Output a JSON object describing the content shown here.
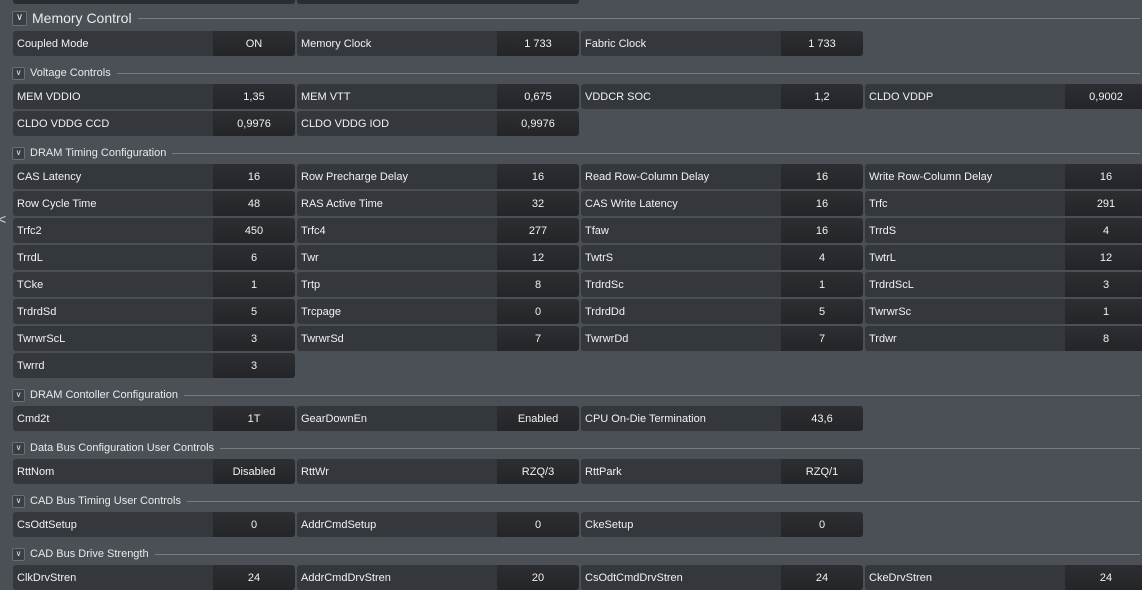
{
  "memory_control": {
    "title": "Memory Control",
    "fields": [
      {
        "label": "Coupled Mode",
        "value": "ON"
      },
      {
        "label": "Memory Clock",
        "value": "1 733"
      },
      {
        "label": "Fabric Clock",
        "value": "1 733"
      }
    ]
  },
  "voltage_controls": {
    "title": "Voltage Controls",
    "rows": [
      [
        {
          "label": "MEM VDDIO",
          "value": "1,35"
        },
        {
          "label": "MEM VTT",
          "value": "0,675"
        },
        {
          "label": "VDDCR SOC",
          "value": "1,2"
        },
        {
          "label": "CLDO VDDP",
          "value": "0,9002"
        }
      ],
      [
        {
          "label": "CLDO VDDG CCD",
          "value": "0,9976"
        },
        {
          "label": "CLDO VDDG IOD",
          "value": "0,9976"
        }
      ]
    ]
  },
  "dram_timing": {
    "title": "DRAM Timing Configuration",
    "rows": [
      [
        {
          "label": "CAS Latency",
          "value": "16"
        },
        {
          "label": "Row Precharge Delay",
          "value": "16"
        },
        {
          "label": "Read Row-Column Delay",
          "value": "16"
        },
        {
          "label": "Write Row-Column Delay",
          "value": "16"
        }
      ],
      [
        {
          "label": "Row Cycle Time",
          "value": "48"
        },
        {
          "label": "RAS Active Time",
          "value": "32"
        },
        {
          "label": "CAS Write Latency",
          "value": "16"
        },
        {
          "label": "Trfc",
          "value": "291"
        }
      ],
      [
        {
          "label": "Trfc2",
          "value": "450"
        },
        {
          "label": "Trfc4",
          "value": "277"
        },
        {
          "label": "Tfaw",
          "value": "16"
        },
        {
          "label": "TrrdS",
          "value": "4"
        }
      ],
      [
        {
          "label": "TrrdL",
          "value": "6"
        },
        {
          "label": "Twr",
          "value": "12"
        },
        {
          "label": "TwtrS",
          "value": "4"
        },
        {
          "label": "TwtrL",
          "value": "12"
        }
      ],
      [
        {
          "label": "TCke",
          "value": "1"
        },
        {
          "label": "Trtp",
          "value": "8"
        },
        {
          "label": "TrdrdSc",
          "value": "1"
        },
        {
          "label": "TrdrdScL",
          "value": "3"
        }
      ],
      [
        {
          "label": "TrdrdSd",
          "value": "5"
        },
        {
          "label": "Trcpage",
          "value": "0"
        },
        {
          "label": "TrdrdDd",
          "value": "5"
        },
        {
          "label": "TwrwrSc",
          "value": "1"
        }
      ],
      [
        {
          "label": "TwrwrScL",
          "value": "3"
        },
        {
          "label": "TwrwrSd",
          "value": "7"
        },
        {
          "label": "TwrwrDd",
          "value": "7"
        },
        {
          "label": "Trdwr",
          "value": "8"
        }
      ],
      [
        {
          "label": "Twrrd",
          "value": "3"
        }
      ]
    ]
  },
  "dram_controller": {
    "title": "DRAM Contoller Configuration",
    "fields": [
      {
        "label": "Cmd2t",
        "value": "1T"
      },
      {
        "label": "GearDownEn",
        "value": "Enabled"
      },
      {
        "label": "CPU On-Die Termination",
        "value": "43,6"
      }
    ]
  },
  "data_bus": {
    "title": "Data Bus Configuration User Controls",
    "fields": [
      {
        "label": "RttNom",
        "value": "Disabled"
      },
      {
        "label": "RttWr",
        "value": "RZQ/3"
      },
      {
        "label": "RttPark",
        "value": "RZQ/1"
      }
    ]
  },
  "cad_timing": {
    "title": "CAD Bus Timing User Controls",
    "fields": [
      {
        "label": "CsOdtSetup",
        "value": "0"
      },
      {
        "label": "AddrCmdSetup",
        "value": "0"
      },
      {
        "label": "CkeSetup",
        "value": "0"
      }
    ]
  },
  "cad_drive": {
    "title": "CAD Bus Drive Strength",
    "fields": [
      {
        "label": "ClkDrvStren",
        "value": "24"
      },
      {
        "label": "AddrCmdDrvStren",
        "value": "20"
      },
      {
        "label": "CsOdtCmdDrvStren",
        "value": "24"
      },
      {
        "label": "CkeDrvStren",
        "value": "24"
      }
    ]
  },
  "icons": {
    "collapse": "chevron-down-icon",
    "edge": "chevron-left-icon"
  },
  "edge_glyph": "<",
  "colors": {
    "background": "#4b4f56",
    "label_bg": "#34373c",
    "value_bg": "#232528",
    "text": "#f2f2f2"
  }
}
